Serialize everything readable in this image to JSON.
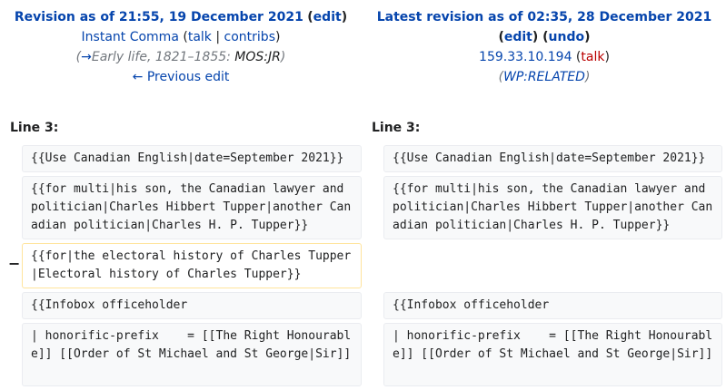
{
  "left_header": {
    "title": "Revision as of 21:55, 19 December 2021",
    "edit_open": "(",
    "edit_label": "edit",
    "edit_close": ")",
    "user": "Instant Comma",
    "talk_open": "(",
    "talk_label": "talk",
    "sep": "|",
    "contribs_label": "contribs",
    "talk_close": ")",
    "summary_open": "(",
    "summary_arrow": "→",
    "summary_section": "Early life, 1821–1855:",
    "summary_text": " MOS:JR",
    "summary_close": ")",
    "prev_edit": "← Previous edit"
  },
  "right_header": {
    "title": "Latest revision as of 02:35, 28 December 2021",
    "edit_open": "(",
    "edit_label": "edit",
    "edit_mid": ") (",
    "undo_label": "undo",
    "undo_close": ")",
    "user": "159.33.10.194",
    "talk_open": " (",
    "talk_label": "talk",
    "talk_close": ")",
    "summary_open": "(",
    "summary_link": "WP:RELATED",
    "summary_close": ")"
  },
  "diff": {
    "left_line_label": "Line 3:",
    "right_line_label": "Line 3:",
    "deleted_marker": "−",
    "rows": [
      {
        "left": "{{Use Canadian English|date=September 2021}}",
        "right": "{{Use Canadian English|date=September 2021}}"
      },
      {
        "left": "{{for multi|his son, the Canadian lawyer and politician|Charles Hibbert Tupper|another Canadian politician|Charles H. P. Tupper}}",
        "right": "{{for multi|his son, the Canadian lawyer and politician|Charles Hibbert Tupper|another Canadian politician|Charles H. P. Tupper}}"
      },
      {
        "left": "{{for|the electoral history of Charles Tupper|Electoral history of Charles Tupper}}",
        "right": ""
      },
      {
        "left": "{{Infobox officeholder",
        "right": "{{Infobox officeholder"
      },
      {
        "left": "| honorific-prefix    = [[The Right Honourable]] [[Order of St Michael and St George|Sir]]",
        "right": "| honorific-prefix    = [[The Right Honourable]] [[Order of St Michael and St George|Sir]]"
      }
    ]
  },
  "colors": {
    "link": "#0645ad",
    "redlink": "#ba0000",
    "deleted_border": "#ffe49c",
    "context_bg": "#f8f9fa"
  }
}
